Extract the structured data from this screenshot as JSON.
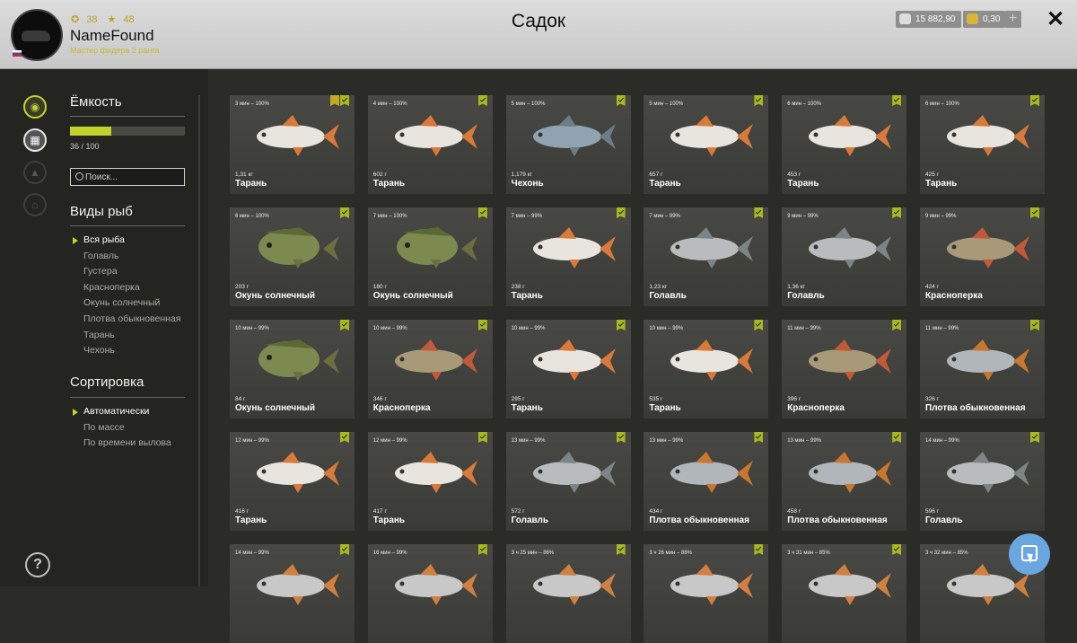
{
  "window": {
    "title": "Садок",
    "close_icon": "close-icon"
  },
  "player": {
    "coins": "38",
    "stars": "48",
    "name": "NameFound",
    "rank": "Мастер фидера 2 ранга"
  },
  "currency": {
    "silver": "15 882,90",
    "gold": "0,30",
    "plus": "+"
  },
  "colors": {
    "accent": "#c3d22a",
    "panel": "#242421",
    "card": "#3f3f3b"
  },
  "sidebar": {
    "icons": [
      "fish-icon",
      "keepnet-icon",
      "fire-icon",
      "home-icon"
    ],
    "help": "?"
  },
  "capacity": {
    "title": "Ёмкость",
    "value": 36,
    "max": 100,
    "label": "36 / 100"
  },
  "search": {
    "placeholder": "Поиск..."
  },
  "species": {
    "title": "Виды рыб",
    "items": [
      "Вся рыба",
      "Голавль",
      "Густера",
      "Красноперка",
      "Окунь солнечный",
      "Плотва обыкновенная",
      "Тарань",
      "Чехонь"
    ]
  },
  "sorting": {
    "title": "Сортировка",
    "items": [
      "Автоматически",
      "По массе",
      "По времени вылова"
    ]
  },
  "fish": [
    {
      "time": "3 мин – 100%",
      "weight": "1,31 кг",
      "name": "Тарань",
      "star": true
    },
    {
      "time": "4 мин – 100%",
      "weight": "602 г",
      "name": "Тарань"
    },
    {
      "time": "5 мин – 100%",
      "weight": "1,179 кг",
      "name": "Чехонь"
    },
    {
      "time": "5 мин – 100%",
      "weight": "657 г",
      "name": "Тарань"
    },
    {
      "time": "6 мин – 100%",
      "weight": "453 г",
      "name": "Тарань"
    },
    {
      "time": "6 мин – 100%",
      "weight": "425 г",
      "name": "Тарань"
    },
    {
      "time": "6 мин – 100%",
      "weight": "203 г",
      "name": "Окунь солнечный"
    },
    {
      "time": "7 мин – 100%",
      "weight": "180 г",
      "name": "Окунь солнечный"
    },
    {
      "time": "7 мин – 99%",
      "weight": "238 г",
      "name": "Тарань"
    },
    {
      "time": "7 мин – 99%",
      "weight": "1,23 кг",
      "name": "Голавль"
    },
    {
      "time": "9 мин – 99%",
      "weight": "1,36 кг",
      "name": "Голавль"
    },
    {
      "time": "9 мин – 99%",
      "weight": "424 г",
      "name": "Красноперка"
    },
    {
      "time": "10 мин – 99%",
      "weight": "84 г",
      "name": "Окунь солнечный"
    },
    {
      "time": "10 мин – 99%",
      "weight": "346 г",
      "name": "Красноперка"
    },
    {
      "time": "10 мин – 99%",
      "weight": "295 г",
      "name": "Тарань"
    },
    {
      "time": "10 мин – 99%",
      "weight": "535 г",
      "name": "Тарань"
    },
    {
      "time": "11 мин – 99%",
      "weight": "396 г",
      "name": "Красноперка"
    },
    {
      "time": "11 мин – 99%",
      "weight": "326 г",
      "name": "Плотва обыкновенная"
    },
    {
      "time": "12 мин – 99%",
      "weight": "416 г",
      "name": "Тарань"
    },
    {
      "time": "12 мин – 99%",
      "weight": "417 г",
      "name": "Тарань"
    },
    {
      "time": "13 мин – 99%",
      "weight": "572 г",
      "name": "Голавль"
    },
    {
      "time": "13 мин – 99%",
      "weight": "434 г",
      "name": "Плотва обыкновенная"
    },
    {
      "time": "13 мин – 99%",
      "weight": "458 г",
      "name": "Плотва обыкновенная"
    },
    {
      "time": "14 мин – 99%",
      "weight": "596 г",
      "name": "Голавль"
    },
    {
      "time": "14 мин – 99%",
      "weight": "",
      "name": ""
    },
    {
      "time": "16 мин – 99%",
      "weight": "",
      "name": ""
    },
    {
      "time": "3 ч 25 мин – 86%",
      "weight": "",
      "name": ""
    },
    {
      "time": "3 ч 26 мин – 86%",
      "weight": "",
      "name": ""
    },
    {
      "time": "3 ч 31 мин – 85%",
      "weight": "",
      "name": ""
    },
    {
      "time": "3 ч 32 мин – 85%",
      "weight": "",
      "name": ""
    }
  ]
}
